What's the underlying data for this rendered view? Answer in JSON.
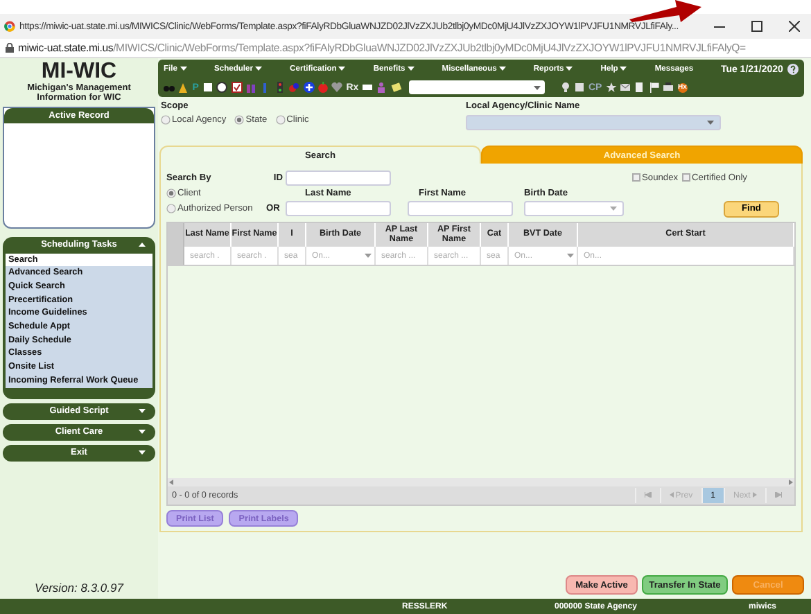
{
  "browser": {
    "title_url": "https://miwic-uat.state.mi.us/MIWICS/Clinic/WebForms/Template.aspx?fiFAlyRDbGluaWNJZD02JlVzZXJUb2tlbj0yMDc0MjU4JlVzZXJOYW1lPVJFU1NMRVJLfiFAly...",
    "address_host": "miwic-uat.state.mi.us",
    "address_path": "/MIWICS/Clinic/WebForms/Template.aspx?fiFAlyRDbGluaWNJZD02JlVzZXJUb2tlbj0yMDc0MjU4JlVzZXJOYW1lPVJFU1NMRVJLfiFAlyQ="
  },
  "logo": {
    "title": "MI-WIC",
    "subtitle": "Michigan's Management Information for WIC"
  },
  "active_record": {
    "title": "Active Record"
  },
  "sidebar": {
    "sections": [
      {
        "title": "Scheduling Tasks",
        "expanded": true,
        "items": [
          {
            "label": "Search",
            "selected": true
          },
          {
            "label": "Advanced Search",
            "selected": false
          },
          {
            "label": "Quick Search",
            "selected": false
          },
          {
            "label": "Precertification",
            "selected": false
          },
          {
            "label": "Income Guidelines",
            "selected": false
          },
          {
            "label": "Schedule Appt",
            "selected": false
          },
          {
            "label": "Daily Schedule",
            "selected": false
          },
          {
            "label": "Classes",
            "selected": false
          },
          {
            "label": "Onsite List",
            "selected": false
          },
          {
            "label": "Incoming Referral Work Queue",
            "selected": false
          }
        ]
      },
      {
        "title": "Guided Script",
        "expanded": false
      },
      {
        "title": "Client Care",
        "expanded": false
      },
      {
        "title": "Exit",
        "expanded": false
      }
    ]
  },
  "version": "Version: 8.3.0.97",
  "menu": [
    "File",
    "Scheduler",
    "Certification",
    "Benefits",
    "Miscellaneous",
    "Reports",
    "Help"
  ],
  "messages": "Messages",
  "date": "Tue 1/21/2020",
  "toolbar_glyphs": {
    "p": "P",
    "rx": "Rx",
    "cp": "CP",
    "hx": "Hx"
  },
  "scope": {
    "label": "Scope",
    "options": [
      {
        "label": "Local Agency",
        "selected": false
      },
      {
        "label": "State",
        "selected": true
      },
      {
        "label": "Clinic",
        "selected": false
      }
    ],
    "agency_label": "Local Agency/Clinic Name"
  },
  "tabs": [
    {
      "label": "Search",
      "selected": true
    },
    {
      "label": "Advanced Search",
      "selected": false
    }
  ],
  "search": {
    "search_by": "Search By",
    "by_options": [
      {
        "label": "Client",
        "selected": true
      },
      {
        "label": "Authorized Person",
        "selected": false
      }
    ],
    "id_label": "ID",
    "or_label": "OR",
    "last_name": "Last Name",
    "first_name": "First Name",
    "birth_date": "Birth Date",
    "checks": [
      {
        "label": "Soundex",
        "checked": false
      },
      {
        "label": "Certified Only",
        "checked": false
      }
    ],
    "find": "Find"
  },
  "table": {
    "columns": [
      {
        "label": "Last Name",
        "filter": "search .",
        "kind": "text"
      },
      {
        "label": "First Name",
        "filter": "search .",
        "kind": "text"
      },
      {
        "label": "I",
        "filter": "sea",
        "kind": "text"
      },
      {
        "label": "Birth Date",
        "filter": "On...",
        "kind": "date"
      },
      {
        "label": "AP Last Name",
        "filter": "search ...",
        "kind": "text"
      },
      {
        "label": "AP First Name",
        "filter": "search ...",
        "kind": "text"
      },
      {
        "label": "Cat",
        "filter": "sea",
        "kind": "text"
      },
      {
        "label": "BVT Date",
        "filter": "On...",
        "kind": "date"
      },
      {
        "label": "Cert Start",
        "filter": "On...",
        "kind": "text"
      }
    ]
  },
  "pager": {
    "records": "0 - 0 of 0 records",
    "prev": "Prev",
    "pages": [
      {
        "label": "1",
        "selected": true
      }
    ],
    "next": "Next"
  },
  "print_buttons": [
    "Print List",
    "Print Labels"
  ],
  "actions": [
    {
      "label": "Make Active",
      "kind": "pink",
      "disabled": false
    },
    {
      "label": "Transfer In State",
      "kind": "green",
      "disabled": false
    },
    {
      "label": "Cancel",
      "kind": "orange",
      "disabled": true
    }
  ],
  "footer": [
    "RESSLERK",
    "000000 State Agency",
    "miwics"
  ]
}
